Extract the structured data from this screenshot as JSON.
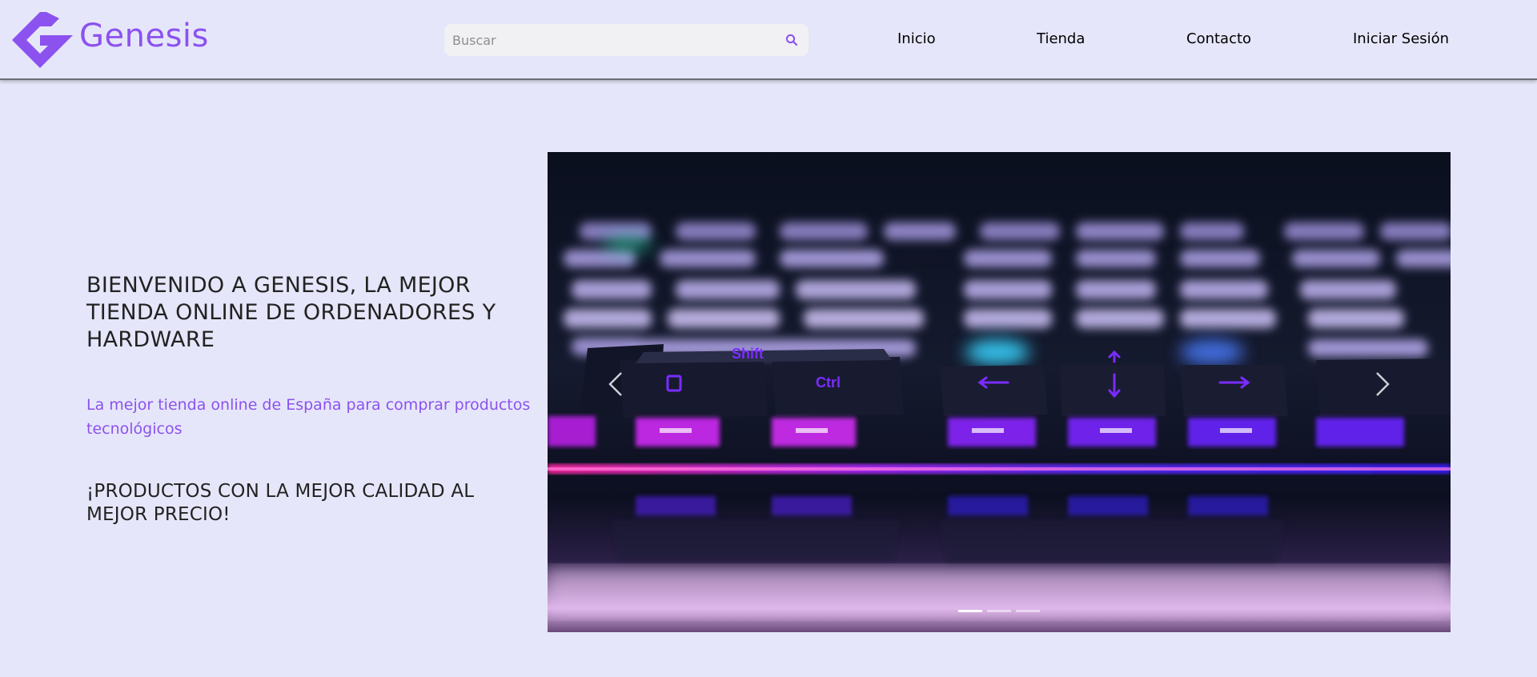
{
  "brand": {
    "name": "Genesis",
    "logo_icon": "genesis-logo-icon",
    "color": "#8b52ef"
  },
  "search": {
    "placeholder": "Buscar",
    "value": "",
    "icon": "search-icon"
  },
  "nav": {
    "items": [
      {
        "label": "Inicio"
      },
      {
        "label": "Tienda"
      },
      {
        "label": "Contacto"
      },
      {
        "label": "Iniciar Sesión"
      }
    ]
  },
  "hero": {
    "title": "BIENVENIDO A GENESIS, LA MEJOR TIENDA ONLINE DE ORDENADORES Y HARDWARE",
    "subtitle": "La mejor tienda online de España para comprar productos tecnológicos",
    "promo": "¡PRODUCTOS CON LA MEJOR CALIDAD AL MEJOR PRECIO!"
  },
  "carousel": {
    "image_subject": "backlit mechanical keyboard",
    "key_legends": [
      "Shift",
      "Ctrl"
    ],
    "slide_count": 3,
    "active_slide": 1,
    "prev_icon": "chevron-left-icon",
    "next_icon": "chevron-right-icon"
  },
  "colors": {
    "background": "#e6e6fa",
    "accent": "#8b52ef",
    "search_background": "#f1f1f3"
  }
}
